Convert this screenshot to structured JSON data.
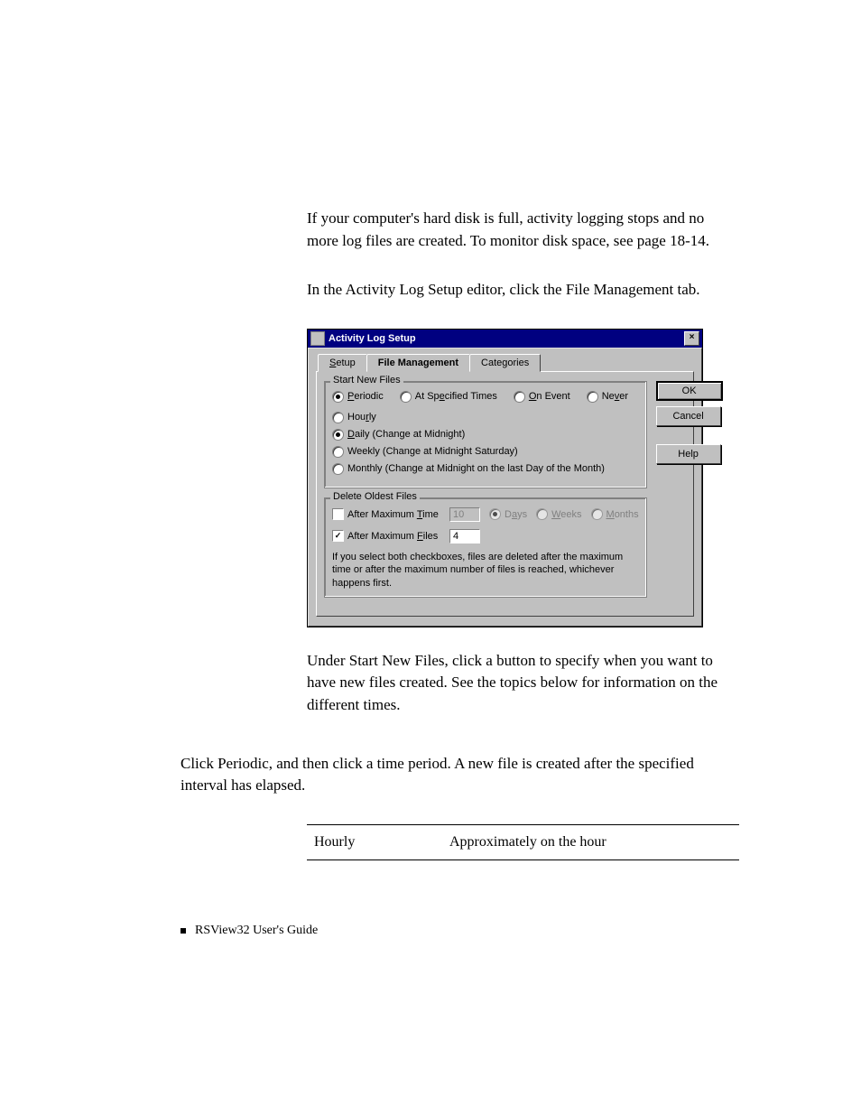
{
  "para1": "If your computer's hard disk is full, activity logging stops and no more log files are created. To monitor disk space, see page 18-14.",
  "para2": "In the Activity Log Setup editor, click the File Management tab.",
  "para3": "Under Start New Files, click a button to specify when you want to have new files created. See the topics below for information on the different times.",
  "para4": "Click Periodic, and then click a time period. A new file is created after the specified interval has elapsed.",
  "dialog": {
    "title": "Activity Log Setup",
    "tabs": {
      "setup": "Setup",
      "file_mgmt": "File Management",
      "categories": "Categories"
    },
    "group_start": {
      "title": "Start New Files",
      "periodic": "Periodic",
      "at_specified": "At Specified Times",
      "on_event": "On Event",
      "never": "Never",
      "hourly": "Hourly",
      "daily": "Daily (Change at Midnight)",
      "weekly": "Weekly (Change at Midnight Saturday)",
      "monthly": "Monthly (Change at Midnight on the last Day of the Month)"
    },
    "group_delete": {
      "title": "Delete Oldest Files",
      "after_time": "After Maximum Time",
      "after_files": "After Maximum Files",
      "time_value": "10",
      "files_value": "4",
      "days": "Days",
      "weeks": "Weeks",
      "months": "Months",
      "note": "If you select both checkboxes, files are deleted after the maximum time or after the maximum number of files is reached, whichever happens first."
    },
    "buttons": {
      "ok": "OK",
      "cancel": "Cancel",
      "help": "Help"
    }
  },
  "table": {
    "row1": {
      "c1": "Hourly",
      "c2": "Approximately on the hour"
    }
  },
  "footer": "RSView32  User's Guide"
}
